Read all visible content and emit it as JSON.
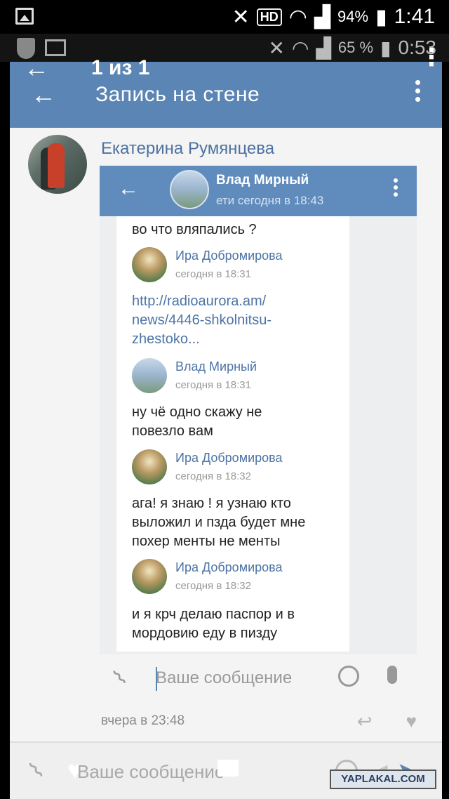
{
  "status_bar": {
    "hd": "HD",
    "battery": "94%",
    "time": "1:41"
  },
  "status_bar_inner": {
    "battery": "65 %",
    "time": "0:53"
  },
  "viewer": {
    "counter": "1 из 1"
  },
  "vk": {
    "title": "Запись на стене",
    "post_author": "Екатерина Румянцева",
    "embedded": {
      "chat_name": "Влад Мирный",
      "seen": "ети сегодня в 18:43",
      "first_line": "во что вляпались ?",
      "messages": [
        {
          "author": "Ира Добромирова",
          "time": "сегодня в 18:31",
          "lines": [
            "http://radioaurora.am/",
            "news/4446-shkolnitsu-",
            "zhestoko..."
          ]
        },
        {
          "author": "Влад Мирный",
          "time": "сегодня в 18:31",
          "lines": [
            "ну чё одно скажу не",
            "повезло вам"
          ]
        },
        {
          "author": "Ира Добромирова",
          "time": "сегодня в 18:32",
          "lines": [
            "ага! я знаю ! я узнаю кто",
            "выложил и пзда будет мне",
            "похер менты не менты"
          ]
        },
        {
          "author": "Ира Добромирова",
          "time": "сегодня в 18:32",
          "lines": [
            "и я крч делаю паспор и в",
            "мордовию еду в пизду"
          ]
        }
      ]
    },
    "inner_compose_placeholder": "Ваше сообщение",
    "post_time": "вчера в 23:48",
    "outer_compose_placeholder": "Ваше сообщение"
  },
  "watermark": "YAPLAKAL.COM"
}
